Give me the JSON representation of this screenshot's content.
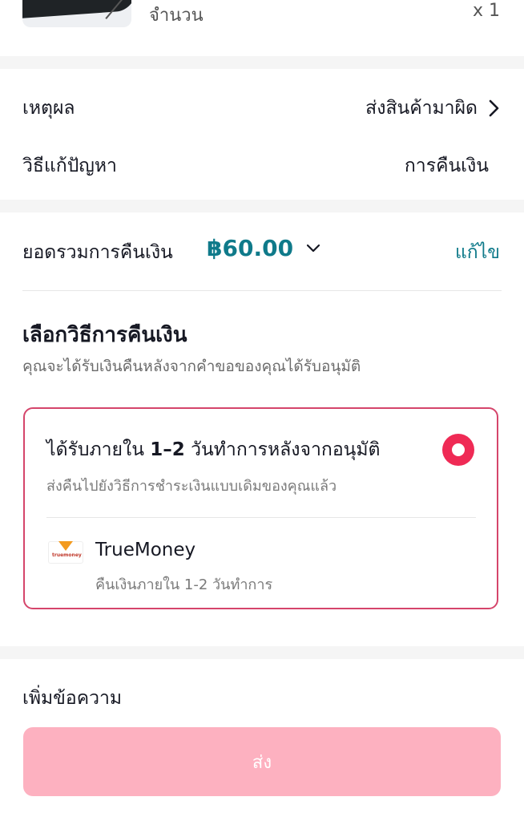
{
  "product": {
    "quantity_label": "จำนวน",
    "quantity_value": "x 1"
  },
  "details": {
    "reason_label": "เหตุผล",
    "reason_value": "ส่งสินค้ามาผิด",
    "resolution_label": "วิธีแก้ปัญหา",
    "resolution_value": "การคืนเงิน"
  },
  "refund_total": {
    "label": "ยอดรวมการคืนเงิน",
    "amount": "฿60.00",
    "edit_label": "แก้ไข"
  },
  "refund_method": {
    "title": "เลือกวิธีการคืนเงิน",
    "subtitle": "คุณจะได้รับเงินคืนหลังจากคำขอของคุณได้รับอนุมัติ",
    "option": {
      "title_prefix": "ได้รับภายใน",
      "title_days": "1–2",
      "title_suffix": "วันทำการหลังจากอนุมัติ",
      "subtitle": "ส่งคืนไปยังวิธีการชำระเงินแบบเดิมของคุณแล้ว",
      "selected": true,
      "wallet_name": "TrueMoney",
      "wallet_logo_text": "truemoney",
      "wallet_note": "คืนเงินภายใน 1-2 วันทำการ"
    }
  },
  "message": {
    "label": "เพิ่มข้อความ"
  },
  "submit": {
    "label": "ส่ง"
  },
  "colors": {
    "accent": "#ef2a55",
    "link": "#0f7a8a",
    "button": "#fdb1c0",
    "card_border": "#d5456b"
  }
}
